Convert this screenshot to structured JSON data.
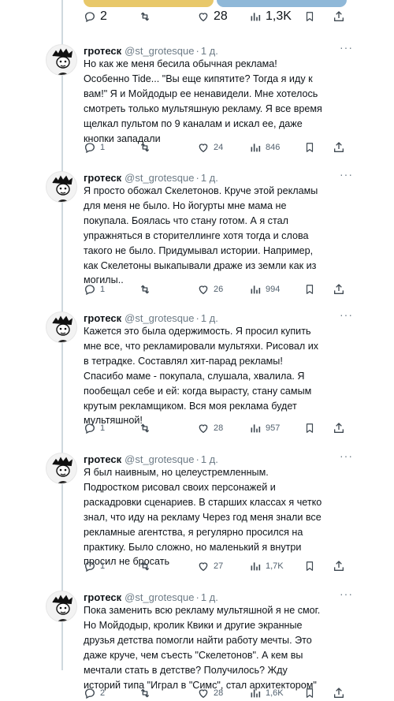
{
  "top_tweet": {
    "replies": "2",
    "likes": "28",
    "views": "1,3K"
  },
  "tweets": [
    {
      "author": "гротеск",
      "handle": "@st_grotesque",
      "time": "1 д.",
      "text": "Но как же меня бесила обычная реклама!\nОсобенно Tide... \"Вы еще кипятите? Тогда я иду к\nвам!\" Я и Мойдодыр ее ненавидели. Мне хотелось\nсмотреть только мультяшную рекламу. Я все время\nщелкал пультом по 9 каналам и искал ее, даже\nкнопки западали",
      "replies": "1",
      "likes": "24",
      "views": "846"
    },
    {
      "author": "гротеск",
      "handle": "@st_grotesque",
      "time": "1 д.",
      "text": "Я просто обожал Скелетонов. Круче этой рекламы\nдля меня не было. Но йогурты мне мама не\nпокупала. Боялась что стану готом. А я стал\nупражняться в сторителлинге хотя тогда и слова\nтакого не было. Придумывал истории. Например,\nкак Скелетоны выкапывали драже из земли как из\nмогилы..",
      "replies": "1",
      "likes": "26",
      "views": "994"
    },
    {
      "author": "гротеск",
      "handle": "@st_grotesque",
      "time": "1 д.",
      "text": "Кажется это была одержимость. Я просил купить\nмне все, что рекламировали мультяхи. Рисовал их\nв тетрадке. Составлял хит-парад рекламы!\nСпасибо маме - покупала, слушала, хвалила. Я\nпообещал себе и ей: когда вырасту, стану самым\nкрутым рекламщиком. Вся моя реклама будет\nмультяшной!",
      "replies": "1",
      "likes": "28",
      "views": "957"
    },
    {
      "author": "гротеск",
      "handle": "@st_grotesque",
      "time": "1 д.",
      "text": "Я был наивным, но целеустремленным.\nПодростком рисовал своих персонажей и\nраскадровки сценариев. В старших классах я четко\nзнал, что иду на рекламу Через год меня знали все\nрекламные агентства, я регулярно просился на\nпрактику. Было сложно, но маленький я внутри\nпросил не бросать",
      "replies": "1",
      "likes": "27",
      "views": "1,7K"
    },
    {
      "author": "гротеск",
      "handle": "@st_grotesque",
      "time": "1 д.",
      "text": "Пока заменить всю рекламу мультяшной я не смог.\nНо Мойдодыр, кролик Квики и другие экранные\nдрузья детства помогли найти работу мечты. Это\nдаже круче, чем съесть \"Скелетонов\". А кем вы\nмечтали стать в детстве? Получилось? Жду\nисторий типа \"Играл в \"Симс\", стал архитектором\"",
      "replies": "2",
      "likes": "28",
      "views": "1,6K"
    }
  ],
  "icons": {
    "reply": "reply-icon",
    "retweet": "retweet-icon",
    "like": "like-icon",
    "views": "views-icon",
    "bookmark": "bookmark-icon",
    "share": "share-icon",
    "more": "more-icon"
  },
  "colors": {
    "text": "#0f1419",
    "muted": "#6d7b86",
    "thread_line": "#cfd9de"
  }
}
